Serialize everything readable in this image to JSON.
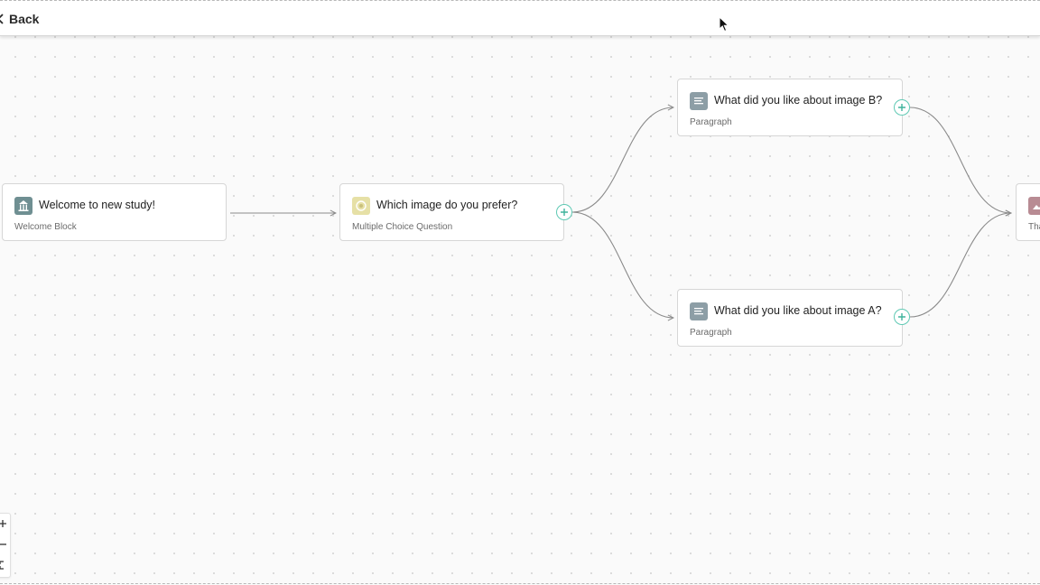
{
  "header": {
    "back_label": "Back"
  },
  "nodes": {
    "welcome": {
      "title": "Welcome to new study!",
      "subtitle": "Welcome Block",
      "icon": "welcome-icon",
      "icon_color": "#6f8f92"
    },
    "choice": {
      "title": "Which image do you prefer?",
      "subtitle": "Multiple Choice Question",
      "icon": "multiple-choice-icon",
      "icon_color": "#e6e0a6"
    },
    "image_b": {
      "title": "What did you like about image B?",
      "subtitle": "Paragraph",
      "icon": "paragraph-icon",
      "icon_color": "#8d9ea6"
    },
    "image_a": {
      "title": "What did you like about image A?",
      "subtitle": "Paragraph",
      "icon": "paragraph-icon",
      "icon_color": "#8d9ea6"
    },
    "thanks": {
      "title": "Tha",
      "subtitle": "",
      "icon": "image-icon",
      "icon_color": "#b88b93"
    }
  },
  "colors": {
    "accent": "#5fc9b4",
    "edge": "#8a8a8a"
  },
  "zoom_controls": {
    "zoom_in": "+",
    "zoom_out": "−",
    "fit": "fit-view-icon"
  }
}
